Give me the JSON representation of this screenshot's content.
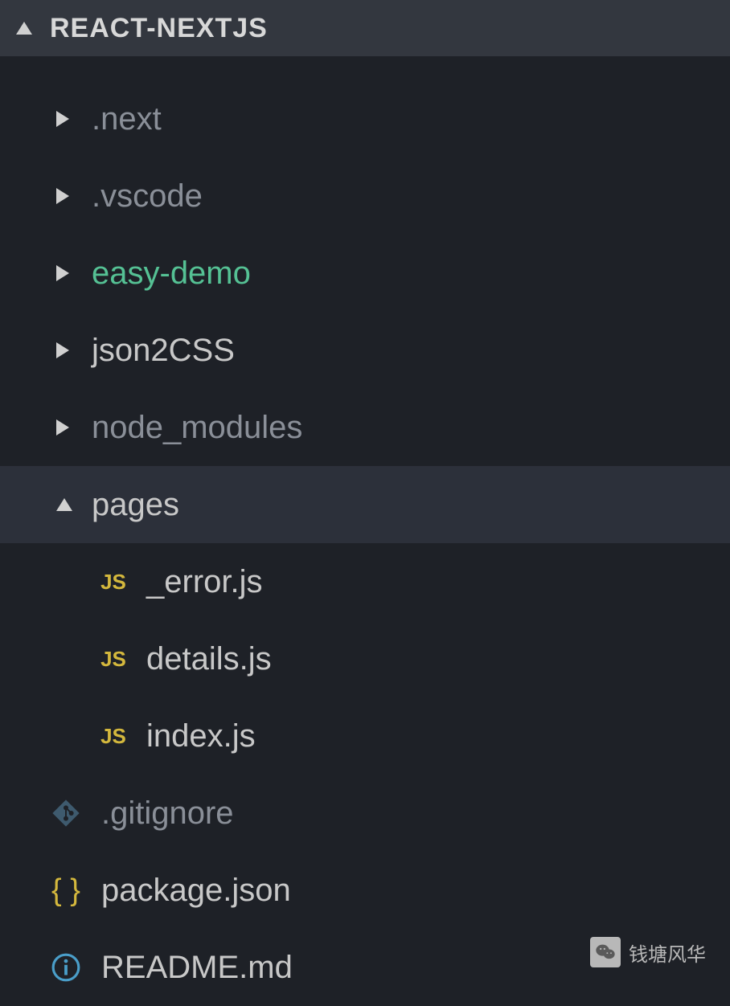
{
  "project": {
    "name": "REACT-NEXTJS"
  },
  "tree": {
    "folders": {
      "next": ".next",
      "vscode": ".vscode",
      "easy_demo": "easy-demo",
      "json2css": "json2CSS",
      "node_modules": "node_modules",
      "pages": "pages"
    },
    "pages_files": {
      "error": "_error.js",
      "details": "details.js",
      "index": "index.js"
    },
    "root_files": {
      "gitignore": ".gitignore",
      "package_json": "package.json",
      "readme": "README.md"
    }
  },
  "icons": {
    "js_label": "JS",
    "json_label": "{ }"
  },
  "watermark": {
    "text": "钱塘风华"
  }
}
